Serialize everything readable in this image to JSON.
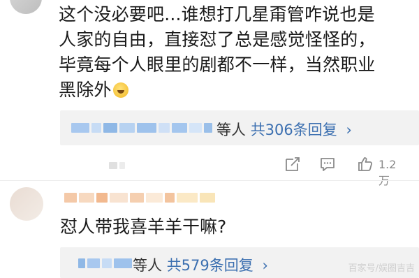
{
  "comment1": {
    "lines": [
      "这个没必要吧...谁想打几星甭管咋说也是",
      "人家的自由，直接怼了总是感觉怪怪的，",
      "毕竟每个人眼里的剧都不一样，当然职业",
      "黑除外"
    ],
    "emoji": "laughing-face-emoji",
    "replies": {
      "suffix": "等人",
      "link": "共306条回复",
      "chevron": "›"
    },
    "likes": "1.2万"
  },
  "comment2": {
    "text": "怼人带我喜羊羊干嘛?",
    "replies": {
      "suffix": "等人",
      "link": "共579条回复",
      "chevron": "›"
    }
  },
  "watermark": "百家号/娱圈吉吉",
  "colors": {
    "link": "#3b6fb0",
    "reply_bg": "#f2f2f2",
    "blur_blue": "#8fb8e6"
  },
  "icons": [
    "share-icon",
    "comment-icon",
    "like-icon"
  ]
}
